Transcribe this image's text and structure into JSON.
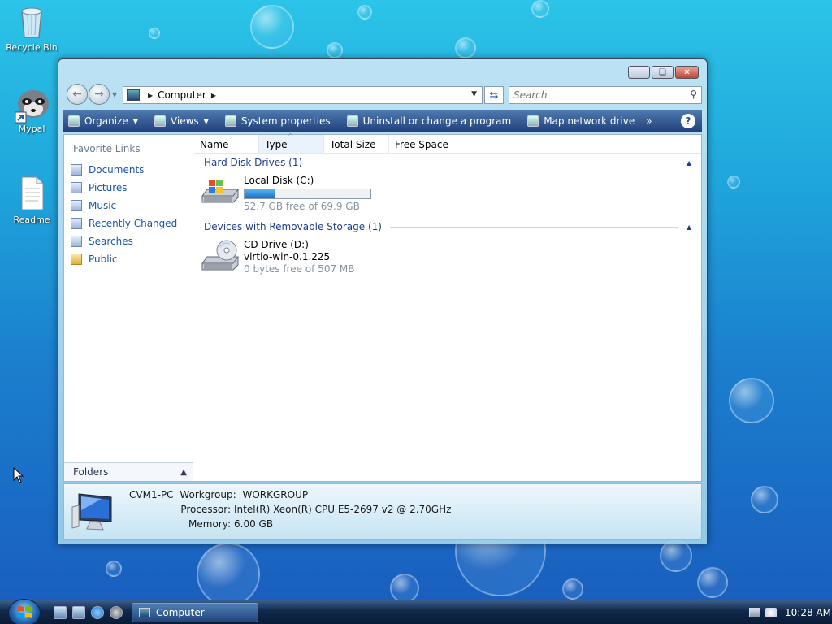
{
  "desktop": {
    "icons": [
      {
        "label": "Recycle Bin",
        "icon": "recycle-bin-icon"
      },
      {
        "label": "Mypal",
        "icon": "mypal-raccoon-icon"
      },
      {
        "label": "Readme",
        "icon": "text-document-icon"
      }
    ]
  },
  "window": {
    "address": {
      "location": "Computer"
    },
    "search": {
      "placeholder": "Search"
    },
    "toolbar": {
      "organize": "Organize",
      "views": "Views",
      "system_properties": "System properties",
      "uninstall": "Uninstall or change a program",
      "map_drive": "Map network drive",
      "more": "»",
      "help": "?"
    },
    "nav_pane": {
      "header": "Favorite Links",
      "links": [
        {
          "label": "Documents",
          "icon": "documents-icon"
        },
        {
          "label": "Pictures",
          "icon": "pictures-icon"
        },
        {
          "label": "Music",
          "icon": "music-icon"
        },
        {
          "label": "Recently Changed",
          "icon": "recently-changed-icon"
        },
        {
          "label": "Searches",
          "icon": "searches-icon"
        },
        {
          "label": "Public",
          "icon": "folder-icon"
        }
      ],
      "folders_label": "Folders"
    },
    "columns": [
      "Name",
      "Type",
      "Total Size",
      "Free Space"
    ],
    "groups": [
      {
        "title": "Hard Disk Drives (1)",
        "items": [
          {
            "name": "Local Disk (C:)",
            "free_text": "52.7 GB free of 69.9 GB",
            "used_fraction": 0.246,
            "icon": "hard-disk-icon"
          }
        ]
      },
      {
        "title": "Devices with Removable Storage (1)",
        "items": [
          {
            "name": "CD Drive (D:)",
            "label": "virtio-win-0.1.225",
            "free_text": "0 bytes free of 507 MB",
            "icon": "cd-drive-icon"
          }
        ]
      }
    ],
    "details": {
      "computer_name": "CVM1-PC",
      "workgroup_label": "Workgroup:",
      "workgroup": "WORKGROUP",
      "processor_label": "Processor:",
      "processor": "Intel(R) Xeon(R) CPU E5-2697 v2 @ 2.70GHz",
      "memory_label": "Memory:",
      "memory": "6.00 GB"
    }
  },
  "taskbar": {
    "task_button": "Computer",
    "clock": "10:28 AM"
  },
  "colors": {
    "link": "#1b55a8",
    "toolbar": "#2a4f8f",
    "group_header": "#1e3d8f"
  }
}
